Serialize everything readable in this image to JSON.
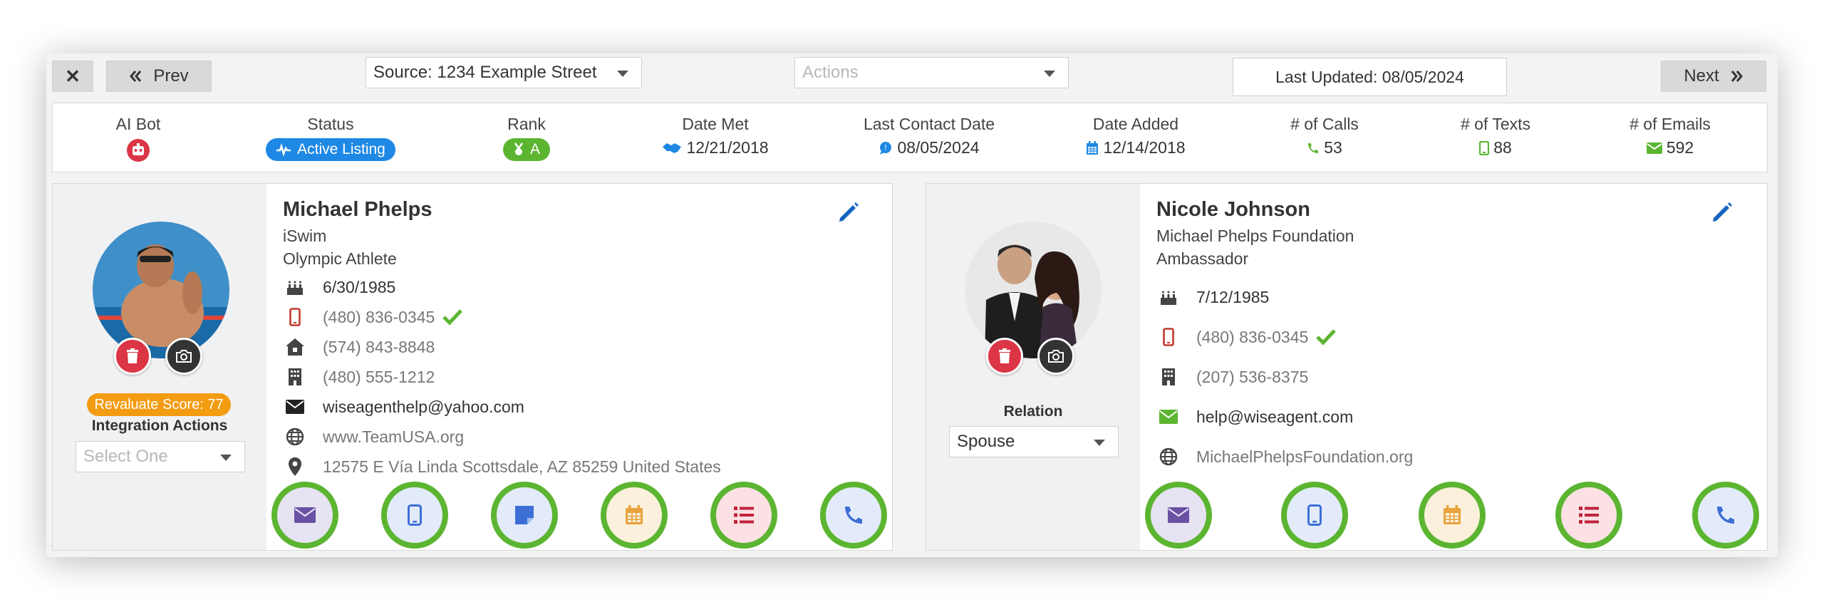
{
  "topbar": {
    "close_label": "✕",
    "prev_label": "Prev",
    "source_value": "Source: 1234 Example Street",
    "actions_placeholder": "Actions",
    "last_updated": "Last Updated: 08/05/2024",
    "next_label": "Next"
  },
  "stats": {
    "ai_bot": {
      "label": "AI Bot"
    },
    "status": {
      "label": "Status",
      "value": "Active Listing"
    },
    "rank": {
      "label": "Rank",
      "value": "A"
    },
    "date_met": {
      "label": "Date Met",
      "value": "12/21/2018"
    },
    "last_contact": {
      "label": "Last Contact Date",
      "value": "08/05/2024"
    },
    "date_added": {
      "label": "Date Added",
      "value": "12/14/2018"
    },
    "calls": {
      "label": "# of Calls",
      "value": "53"
    },
    "texts": {
      "label": "# of Texts",
      "value": "88"
    },
    "emails": {
      "label": "# of Emails",
      "value": "592"
    }
  },
  "colors": {
    "status_blue": "#1e88e5",
    "rank_green": "#5cb531",
    "action_ring": "#5cb531",
    "delete_red": "#dc3545",
    "score_orange": "#f39c12"
  },
  "primary": {
    "name": "Michael Phelps",
    "company": "iSwim",
    "title": "Olympic Athlete",
    "birthday": "6/30/1985",
    "mobile": "(480) 836-0345",
    "home": "(574) 843-8848",
    "office": "(480) 555-1212",
    "email": "wiseagenthelp@yahoo.com",
    "website": "www.TeamUSA.org",
    "address": "12575 E Vía Linda Scottsdale, AZ 85259 United States",
    "score": "Revaluate Score: 77",
    "integration_label": "Integration Actions",
    "integration_placeholder": "Select One"
  },
  "secondary": {
    "name": "Nicole Johnson",
    "company": "Michael Phelps Foundation",
    "title": "Ambassador",
    "birthday": "7/12/1985",
    "mobile": "(480) 836-0345",
    "office": "(207) 536-8375",
    "email": "help@wiseagent.com",
    "website": "MichaelPhelpsFoundation.org",
    "relation_label": "Relation",
    "relation_value": "Spouse"
  }
}
